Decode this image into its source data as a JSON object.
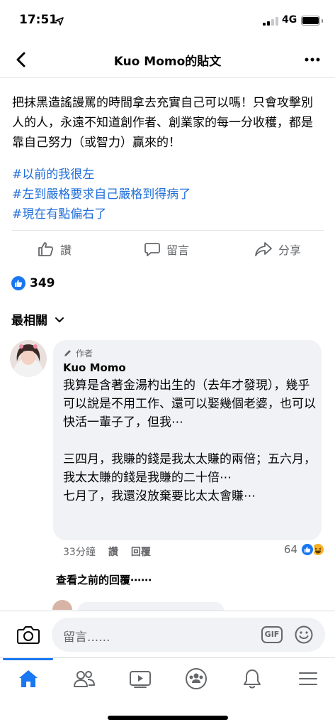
{
  "status_bar": {
    "time": "17:51",
    "network": "4G"
  },
  "header": {
    "title": "Kuo Momo的貼文"
  },
  "post": {
    "text": "把抹黑造謠謾罵的時間拿去充實自己可以嗎！只會攻擊別人的人，永遠不知道創作者、創業家的每一分收穫，都是靠自己努力（或智力）贏來的！",
    "hashtags": [
      "#以前的我很左",
      "#左到嚴格要求自己嚴格到得病了",
      "#現在有點偏右了"
    ]
  },
  "actions": {
    "like": "讚",
    "comment": "留言",
    "share": "分享"
  },
  "reactions": {
    "count": "349"
  },
  "sort": {
    "label": "最相關"
  },
  "comment": {
    "badge": "作者",
    "author": "Kuo Momo",
    "text": "我算是含著金湯杓出生的（去年才發現），幾乎可以說是不用工作、還可以娶幾個老婆，也可以快活一輩子了，但我⋯\n\n三四月，我賺的錢是我太太賺的兩倍；五六月，我太太賺的錢是我賺的二十倍⋯\n七月了，我還沒放棄要比太太會賺⋯",
    "time": "33分鐘",
    "like": "讚",
    "reply": "回覆",
    "reaction_count": "64"
  },
  "previous_replies": "查看之前的回覆⋯⋯",
  "composer": {
    "placeholder": "留言......",
    "gif": "GIF"
  },
  "tabbar": {
    "items": [
      "home-icon",
      "friends-icon",
      "watch-icon",
      "groups-icon",
      "notifications-icon",
      "menu-icon"
    ],
    "active_color": "#1877f2"
  },
  "colors": {
    "accent": "#1877f2",
    "hashtag": "#216fdb",
    "muted": "#65676b"
  }
}
